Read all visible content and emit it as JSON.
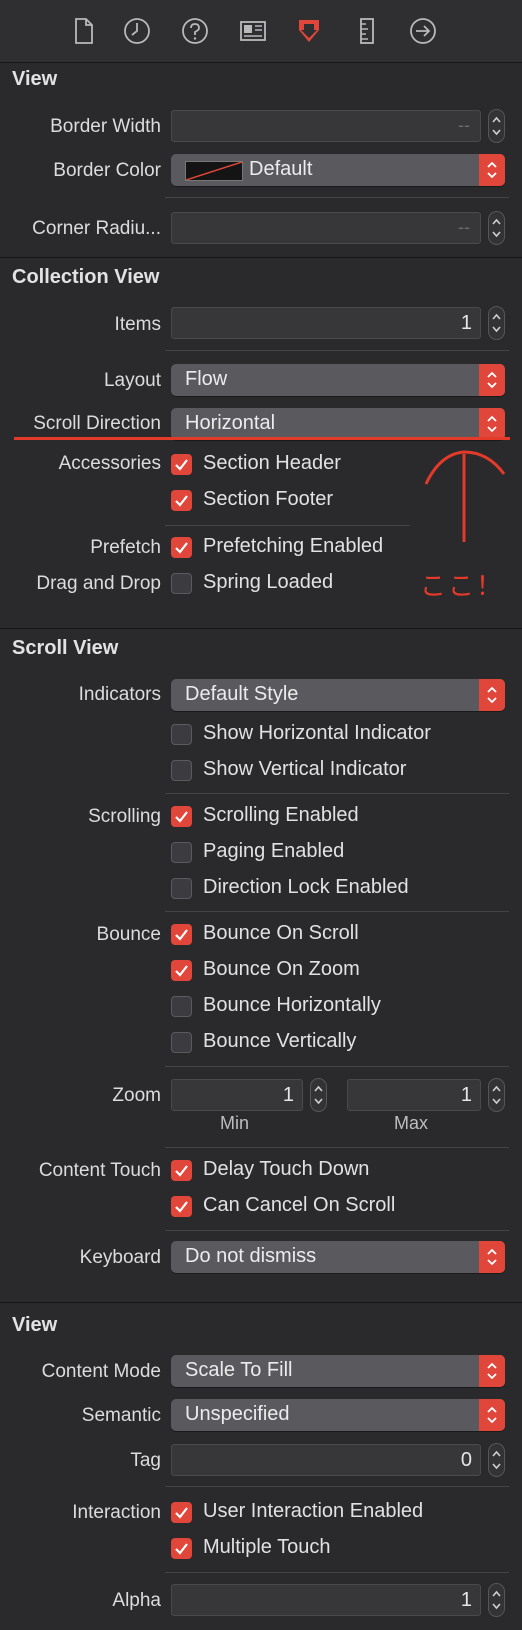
{
  "toolbar": {
    "icons": [
      "file-inspector-icon",
      "history-icon",
      "help-icon",
      "identity-icon",
      "attributes-icon",
      "size-icon",
      "connections-icon"
    ]
  },
  "view_section": {
    "title": "View",
    "border_width_label": "Border Width",
    "border_width_placeholder": "--",
    "border_color_label": "Border Color",
    "border_color_value": "Default",
    "corner_radius_label": "Corner Radiu...",
    "corner_radius_placeholder": "--"
  },
  "collection_section": {
    "title": "Collection View",
    "items_label": "Items",
    "items_value": "1",
    "layout_label": "Layout",
    "layout_value": "Flow",
    "scroll_direction_label": "Scroll Direction",
    "scroll_direction_value": "Horizontal",
    "accessories_label": "Accessories",
    "section_header": "Section Header",
    "section_footer": "Section Footer",
    "prefetch_label": "Prefetch",
    "prefetching_enabled": "Prefetching Enabled",
    "drag_drop_label": "Drag and Drop",
    "spring_loaded": "Spring Loaded",
    "annotation": "ここ！"
  },
  "scroll_section": {
    "title": "Scroll View",
    "indicators_label": "Indicators",
    "indicators_value": "Default Style",
    "show_horizontal": "Show Horizontal Indicator",
    "show_vertical": "Show Vertical Indicator",
    "scrolling_label": "Scrolling",
    "scrolling_enabled": "Scrolling Enabled",
    "paging_enabled": "Paging Enabled",
    "direction_lock": "Direction Lock Enabled",
    "bounce_label": "Bounce",
    "bounce_on_scroll": "Bounce On Scroll",
    "bounce_on_zoom": "Bounce On Zoom",
    "bounce_horizontally": "Bounce Horizontally",
    "bounce_vertically": "Bounce Vertically",
    "zoom_label": "Zoom",
    "zoom_min_value": "1",
    "zoom_max_value": "1",
    "zoom_min_label": "Min",
    "zoom_max_label": "Max",
    "content_touch_label": "Content Touch",
    "delay_touch_down": "Delay Touch Down",
    "can_cancel_on_scroll": "Can Cancel On Scroll",
    "keyboard_label": "Keyboard",
    "keyboard_value": "Do not dismiss"
  },
  "view2_section": {
    "title": "View",
    "content_mode_label": "Content Mode",
    "content_mode_value": "Scale To Fill",
    "semantic_label": "Semantic",
    "semantic_value": "Unspecified",
    "tag_label": "Tag",
    "tag_value": "0",
    "interaction_label": "Interaction",
    "user_interaction_enabled": "User Interaction Enabled",
    "multiple_touch": "Multiple Touch",
    "alpha_label": "Alpha",
    "alpha_value": "1"
  },
  "colors": {
    "accent": "#e0473a",
    "annotation": "#e33a2a",
    "background": "#2a2a2d"
  }
}
